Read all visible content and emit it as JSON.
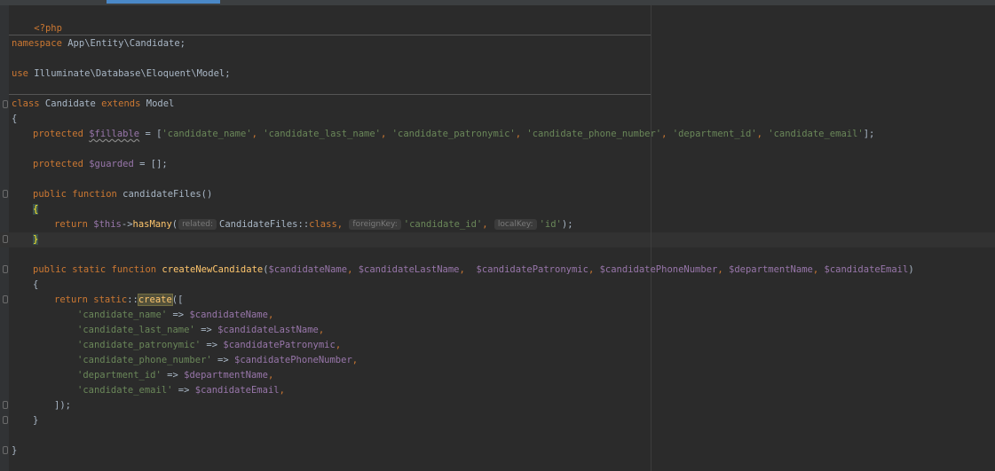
{
  "editor": {
    "language": "PHP",
    "colors": {
      "background": "#2b2b2b",
      "keyword": "#cc7832",
      "variable": "#9876aa",
      "string": "#6a8759",
      "function": "#ffc66d",
      "text": "#a9b7c6"
    }
  },
  "code": {
    "php_open": "<?php",
    "namespace_kw": "namespace",
    "namespace_name": " App\\Entity\\Candidate;",
    "use_kw": "use",
    "use_name": " Illuminate\\Database\\Eloquent\\Model;",
    "class_kw": "class",
    "class_name": " Candidate ",
    "extends_kw": "extends",
    "parent_name": " Model",
    "open_brace": "{",
    "close_brace": "}",
    "fillable": {
      "modifier": "protected",
      "var": "$fillable",
      "assign": " = [",
      "items": [
        "'candidate_name'",
        "'candidate_last_name'",
        "'candidate_patronymic'",
        "'candidate_phone_number'",
        "'department_id'",
        "'candidate_email'"
      ],
      "comma": ", ",
      "end": "];"
    },
    "guarded": {
      "modifier": "protected",
      "var": "$guarded",
      "rest": " = [];"
    },
    "files_method": {
      "modifier": "public",
      "function_kw": "function",
      "name": " candidateFiles()",
      "return_kw": "return",
      "this_var": "$this",
      "arrow": "->",
      "call": "hasMany",
      "open_paren": "(",
      "hint_related": "related:",
      "class_ref": "CandidateFiles::",
      "class_kw": "class",
      "comma": ", ",
      "hint_foreign": "foreignKey:",
      "foreign_value": "'candidate_id'",
      "hint_local": "localKey:",
      "local_value": "'id'",
      "end": ");"
    },
    "create_method": {
      "modifier": "public static",
      "function_kw": "function",
      "name": "createNewCandidate",
      "open_paren": "(",
      "params": [
        "$candidateName",
        "$candidateLastName",
        " $candidatePatronymic",
        "$candidatePhoneNumber",
        "$departmentName",
        "$candidateEmail"
      ],
      "comma": ", ",
      "close_paren": ")",
      "return_kw": "return",
      "static_kw": "static",
      "scope": "::",
      "create_call": "create",
      "create_open": "([",
      "pairs": [
        {
          "key": "'candidate_name'",
          "value": "$candidateName"
        },
        {
          "key": "'candidate_last_name'",
          "value": "$candidateLastName"
        },
        {
          "key": "'candidate_patronymic'",
          "value": "$candidatePatronymic"
        },
        {
          "key": "'candidate_phone_number'",
          "value": "$candidatePhoneNumber"
        },
        {
          "key": "'department_id'",
          "value": "$departmentName"
        },
        {
          "key": "'candidate_email'",
          "value": "$candidateEmail"
        }
      ],
      "pair_arrow": " => ",
      "pair_end": ",",
      "create_close": "]);"
    }
  }
}
